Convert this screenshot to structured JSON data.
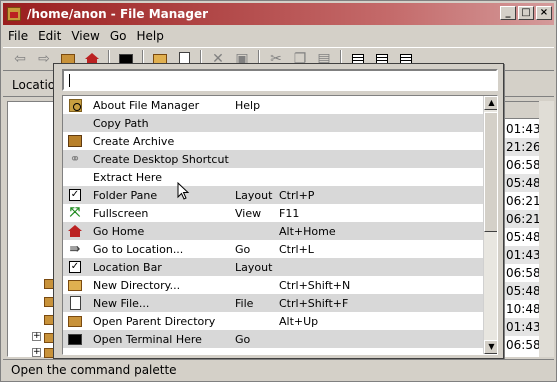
{
  "window": {
    "title": "/home/anon - File Manager",
    "controls": {
      "minimize": "_",
      "maximize": "□",
      "close": "×"
    }
  },
  "menubar": {
    "items": [
      {
        "label": "File",
        "mnemonic": "F"
      },
      {
        "label": "Edit",
        "mnemonic": "E"
      },
      {
        "label": "View",
        "mnemonic": "V"
      },
      {
        "label": "Go",
        "mnemonic": "G"
      },
      {
        "label": "Help",
        "mnemonic": "H"
      }
    ]
  },
  "location": {
    "label": "Location"
  },
  "background_list": {
    "times": [
      "01:43",
      "21:26",
      "06:58",
      "05:48",
      "06:21",
      "06:21",
      "05:48",
      "01:43",
      "06:58",
      "05:48",
      "10:48",
      "01:43",
      "06:58"
    ]
  },
  "palette": {
    "query": "",
    "commands": [
      {
        "icon": "magnifier-icon",
        "name": "About File Manager",
        "group": "Help",
        "shortcut": ""
      },
      {
        "icon": "",
        "name": "Copy Path",
        "group": "",
        "shortcut": ""
      },
      {
        "icon": "archive-icon",
        "name": "Create Archive",
        "group": "",
        "shortcut": ""
      },
      {
        "icon": "link-icon",
        "name": "Create Desktop Shortcut",
        "group": "",
        "shortcut": ""
      },
      {
        "icon": "",
        "name": "Extract Here",
        "group": "",
        "shortcut": ""
      },
      {
        "icon": "checkbox-icon",
        "name": "Folder Pane",
        "group": "Layout",
        "shortcut": "Ctrl+P"
      },
      {
        "icon": "fullscreen-icon",
        "name": "Fullscreen",
        "group": "View",
        "shortcut": "F11"
      },
      {
        "icon": "home-icon",
        "name": "Go Home",
        "group": "",
        "shortcut": "Alt+Home"
      },
      {
        "icon": "arrow-right-icon",
        "name": "Go to Location...",
        "group": "Go",
        "shortcut": "Ctrl+L"
      },
      {
        "icon": "checkbox-icon",
        "name": "Location Bar",
        "group": "Layout",
        "shortcut": ""
      },
      {
        "icon": "new-folder-icon",
        "name": "New Directory...",
        "group": "",
        "shortcut": "Ctrl+Shift+N"
      },
      {
        "icon": "file-icon",
        "name": "New File...",
        "group": "File",
        "shortcut": "Ctrl+Shift+F"
      },
      {
        "icon": "parent-folder-icon",
        "name": "Open Parent Directory",
        "group": "",
        "shortcut": "Alt+Up"
      },
      {
        "icon": "terminal-icon",
        "name": "Open Terminal Here",
        "group": "Go",
        "shortcut": ""
      }
    ],
    "scroll": {
      "up": "▲",
      "down": "▼"
    }
  },
  "statusbar": {
    "text": "Open the command palette"
  },
  "colors": {
    "titlebar_start": "#9a1e1e",
    "window_bg": "#d4d0c8",
    "row_alt": "#d8d8d8"
  }
}
